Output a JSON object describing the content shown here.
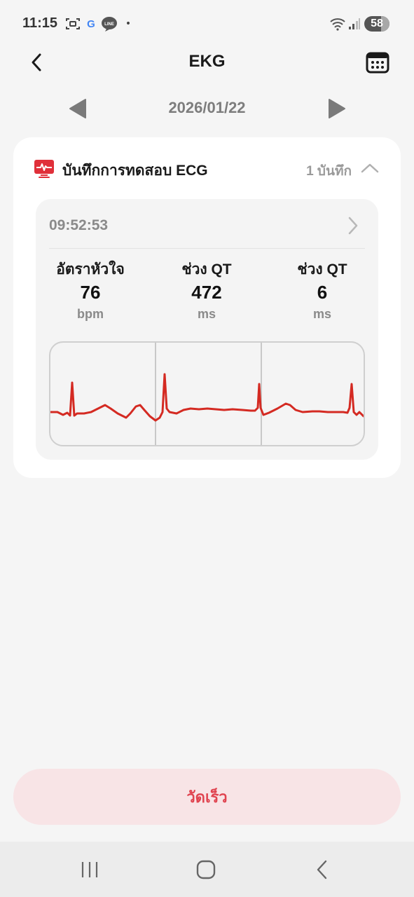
{
  "status_bar": {
    "time": "11:15",
    "google_letter": "G",
    "notification_dot": "•",
    "battery_level": "58",
    "icons": [
      "screenshot-icon",
      "google-icon",
      "line-app-icon",
      "wifi-icon",
      "signal-icon",
      "battery-icon"
    ]
  },
  "header": {
    "title": "EKG",
    "back_icon": "chevron-left-icon",
    "calendar_icon": "calendar-icon"
  },
  "date_nav": {
    "date": "2026/01/22",
    "prev_icon": "triangle-left-icon",
    "next_icon": "triangle-right-icon"
  },
  "card": {
    "title": "บันทึกการทดสอบ ECG",
    "count": "1 บันทึก",
    "icon": "ecg-monitor-icon",
    "collapse_icon": "chevron-up-icon",
    "record": {
      "time": "09:52:53",
      "metrics": [
        {
          "label": "อัตราหัวใจ",
          "value": "76",
          "unit": "bpm"
        },
        {
          "label": "ช่วง QT",
          "value": "472",
          "unit": "ms"
        },
        {
          "label": "ช่วง QT",
          "value": "6",
          "unit": "ms"
        }
      ]
    }
  },
  "measure_button": {
    "label": "วัดเร็ว"
  },
  "colors": {
    "accent_red": "#e0434f",
    "ecg_line": "#d42a22",
    "button_bg": "#f8e4e6",
    "background": "#f5f5f5"
  }
}
